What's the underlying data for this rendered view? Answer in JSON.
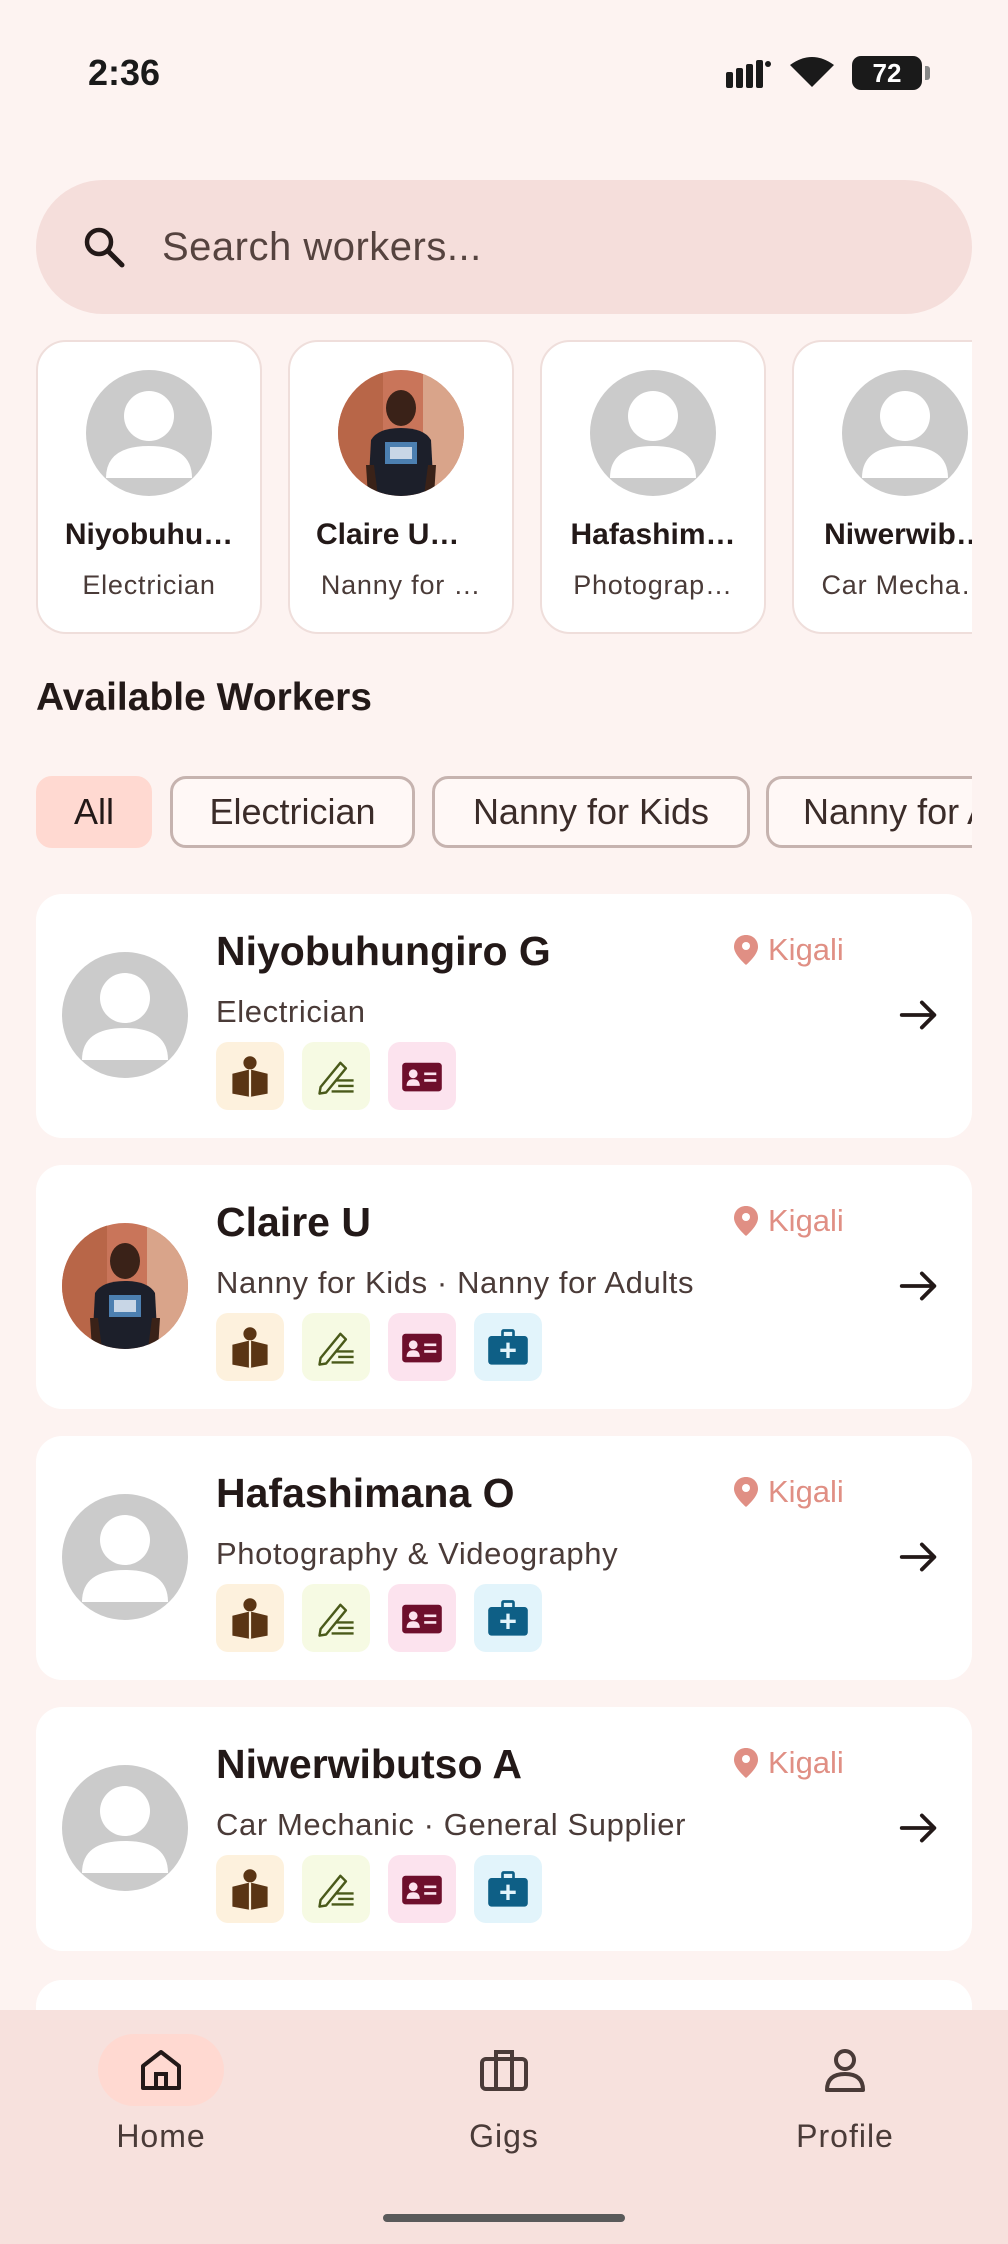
{
  "status": {
    "time": "2:36",
    "battery": "72"
  },
  "search": {
    "placeholder": "Search workers..."
  },
  "featured": [
    {
      "name": "Niyobuhu…",
      "role": "Electrician",
      "photo": "placeholder"
    },
    {
      "name": "Claire UW…",
      "role": "Nanny for …",
      "photo": "person-photo"
    },
    {
      "name": "Hafashim…",
      "role": "Photograp…",
      "photo": "placeholder"
    },
    {
      "name": "Niwerwib…",
      "role": "Car Mecha…",
      "photo": "placeholder"
    }
  ],
  "section_title": "Available Workers",
  "filters": [
    {
      "label": "All",
      "selected": true
    },
    {
      "label": "Electrician",
      "selected": false
    },
    {
      "label": "Nanny for Kids",
      "selected": false
    },
    {
      "label": "Nanny for Adults",
      "selected": false
    }
  ],
  "workers": [
    {
      "name": "Niyobuhungiro G",
      "role": "Electrician",
      "location": "Kigali",
      "badges": [
        "book-icon",
        "note-icon",
        "id-card-icon"
      ]
    },
    {
      "name": "Claire U",
      "role": "Nanny for Kids · Nanny for Adults",
      "location": "Kigali",
      "badges": [
        "book-icon",
        "note-icon",
        "id-card-icon",
        "medical-kit-icon"
      ]
    },
    {
      "name": "Hafashimana O",
      "role": "Photography & Videography",
      "location": "Kigali",
      "badges": [
        "book-icon",
        "note-icon",
        "id-card-icon",
        "medical-kit-icon"
      ]
    },
    {
      "name": "Niwerwibutso A",
      "role": "Car Mechanic · General Supplier",
      "location": "Kigali",
      "badges": [
        "book-icon",
        "note-icon",
        "id-card-icon",
        "medical-kit-icon"
      ]
    }
  ],
  "nav": [
    {
      "label": "Home",
      "icon": "home-icon",
      "active": true
    },
    {
      "label": "Gigs",
      "icon": "briefcase-icon",
      "active": false
    },
    {
      "label": "Profile",
      "icon": "person-icon",
      "active": false
    }
  ],
  "colors": {
    "background": "#fdf3f1",
    "accent": "#ffd9d1",
    "location": "#e08f84"
  }
}
